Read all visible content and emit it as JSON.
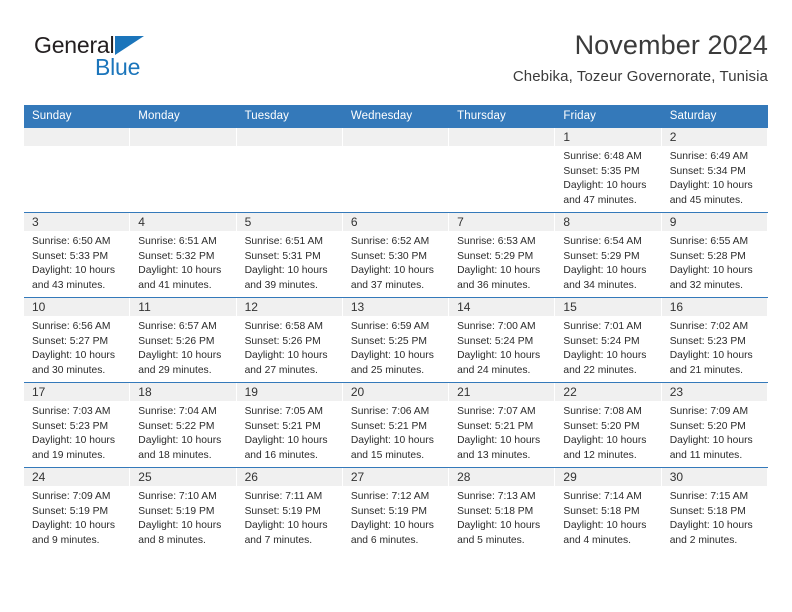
{
  "brand": {
    "name_part1": "General",
    "name_part2": "Blue",
    "logo_icon": "blue-triangle-icon",
    "accent_color": "#1b75bb"
  },
  "header": {
    "title": "November 2024",
    "subtitle": "Chebika, Tozeur Governorate, Tunisia"
  },
  "colors": {
    "header_row_background": "#3479ba",
    "daynum_band_background": "#f0f0f0",
    "text": "#2b2b2b",
    "page_background": "#ffffff"
  },
  "weekday_headers": [
    "Sunday",
    "Monday",
    "Tuesday",
    "Wednesday",
    "Thursday",
    "Friday",
    "Saturday"
  ],
  "weeks": [
    [
      {
        "day": "",
        "sunrise": "",
        "sunset": "",
        "daylight_line1": "",
        "daylight_line2": ""
      },
      {
        "day": "",
        "sunrise": "",
        "sunset": "",
        "daylight_line1": "",
        "daylight_line2": ""
      },
      {
        "day": "",
        "sunrise": "",
        "sunset": "",
        "daylight_line1": "",
        "daylight_line2": ""
      },
      {
        "day": "",
        "sunrise": "",
        "sunset": "",
        "daylight_line1": "",
        "daylight_line2": ""
      },
      {
        "day": "",
        "sunrise": "",
        "sunset": "",
        "daylight_line1": "",
        "daylight_line2": ""
      },
      {
        "day": "1",
        "sunrise": "Sunrise: 6:48 AM",
        "sunset": "Sunset: 5:35 PM",
        "daylight_line1": "Daylight: 10 hours",
        "daylight_line2": "and 47 minutes."
      },
      {
        "day": "2",
        "sunrise": "Sunrise: 6:49 AM",
        "sunset": "Sunset: 5:34 PM",
        "daylight_line1": "Daylight: 10 hours",
        "daylight_line2": "and 45 minutes."
      }
    ],
    [
      {
        "day": "3",
        "sunrise": "Sunrise: 6:50 AM",
        "sunset": "Sunset: 5:33 PM",
        "daylight_line1": "Daylight: 10 hours",
        "daylight_line2": "and 43 minutes."
      },
      {
        "day": "4",
        "sunrise": "Sunrise: 6:51 AM",
        "sunset": "Sunset: 5:32 PM",
        "daylight_line1": "Daylight: 10 hours",
        "daylight_line2": "and 41 minutes."
      },
      {
        "day": "5",
        "sunrise": "Sunrise: 6:51 AM",
        "sunset": "Sunset: 5:31 PM",
        "daylight_line1": "Daylight: 10 hours",
        "daylight_line2": "and 39 minutes."
      },
      {
        "day": "6",
        "sunrise": "Sunrise: 6:52 AM",
        "sunset": "Sunset: 5:30 PM",
        "daylight_line1": "Daylight: 10 hours",
        "daylight_line2": "and 37 minutes."
      },
      {
        "day": "7",
        "sunrise": "Sunrise: 6:53 AM",
        "sunset": "Sunset: 5:29 PM",
        "daylight_line1": "Daylight: 10 hours",
        "daylight_line2": "and 36 minutes."
      },
      {
        "day": "8",
        "sunrise": "Sunrise: 6:54 AM",
        "sunset": "Sunset: 5:29 PM",
        "daylight_line1": "Daylight: 10 hours",
        "daylight_line2": "and 34 minutes."
      },
      {
        "day": "9",
        "sunrise": "Sunrise: 6:55 AM",
        "sunset": "Sunset: 5:28 PM",
        "daylight_line1": "Daylight: 10 hours",
        "daylight_line2": "and 32 minutes."
      }
    ],
    [
      {
        "day": "10",
        "sunrise": "Sunrise: 6:56 AM",
        "sunset": "Sunset: 5:27 PM",
        "daylight_line1": "Daylight: 10 hours",
        "daylight_line2": "and 30 minutes."
      },
      {
        "day": "11",
        "sunrise": "Sunrise: 6:57 AM",
        "sunset": "Sunset: 5:26 PM",
        "daylight_line1": "Daylight: 10 hours",
        "daylight_line2": "and 29 minutes."
      },
      {
        "day": "12",
        "sunrise": "Sunrise: 6:58 AM",
        "sunset": "Sunset: 5:26 PM",
        "daylight_line1": "Daylight: 10 hours",
        "daylight_line2": "and 27 minutes."
      },
      {
        "day": "13",
        "sunrise": "Sunrise: 6:59 AM",
        "sunset": "Sunset: 5:25 PM",
        "daylight_line1": "Daylight: 10 hours",
        "daylight_line2": "and 25 minutes."
      },
      {
        "day": "14",
        "sunrise": "Sunrise: 7:00 AM",
        "sunset": "Sunset: 5:24 PM",
        "daylight_line1": "Daylight: 10 hours",
        "daylight_line2": "and 24 minutes."
      },
      {
        "day": "15",
        "sunrise": "Sunrise: 7:01 AM",
        "sunset": "Sunset: 5:24 PM",
        "daylight_line1": "Daylight: 10 hours",
        "daylight_line2": "and 22 minutes."
      },
      {
        "day": "16",
        "sunrise": "Sunrise: 7:02 AM",
        "sunset": "Sunset: 5:23 PM",
        "daylight_line1": "Daylight: 10 hours",
        "daylight_line2": "and 21 minutes."
      }
    ],
    [
      {
        "day": "17",
        "sunrise": "Sunrise: 7:03 AM",
        "sunset": "Sunset: 5:23 PM",
        "daylight_line1": "Daylight: 10 hours",
        "daylight_line2": "and 19 minutes."
      },
      {
        "day": "18",
        "sunrise": "Sunrise: 7:04 AM",
        "sunset": "Sunset: 5:22 PM",
        "daylight_line1": "Daylight: 10 hours",
        "daylight_line2": "and 18 minutes."
      },
      {
        "day": "19",
        "sunrise": "Sunrise: 7:05 AM",
        "sunset": "Sunset: 5:21 PM",
        "daylight_line1": "Daylight: 10 hours",
        "daylight_line2": "and 16 minutes."
      },
      {
        "day": "20",
        "sunrise": "Sunrise: 7:06 AM",
        "sunset": "Sunset: 5:21 PM",
        "daylight_line1": "Daylight: 10 hours",
        "daylight_line2": "and 15 minutes."
      },
      {
        "day": "21",
        "sunrise": "Sunrise: 7:07 AM",
        "sunset": "Sunset: 5:21 PM",
        "daylight_line1": "Daylight: 10 hours",
        "daylight_line2": "and 13 minutes."
      },
      {
        "day": "22",
        "sunrise": "Sunrise: 7:08 AM",
        "sunset": "Sunset: 5:20 PM",
        "daylight_line1": "Daylight: 10 hours",
        "daylight_line2": "and 12 minutes."
      },
      {
        "day": "23",
        "sunrise": "Sunrise: 7:09 AM",
        "sunset": "Sunset: 5:20 PM",
        "daylight_line1": "Daylight: 10 hours",
        "daylight_line2": "and 11 minutes."
      }
    ],
    [
      {
        "day": "24",
        "sunrise": "Sunrise: 7:09 AM",
        "sunset": "Sunset: 5:19 PM",
        "daylight_line1": "Daylight: 10 hours",
        "daylight_line2": "and 9 minutes."
      },
      {
        "day": "25",
        "sunrise": "Sunrise: 7:10 AM",
        "sunset": "Sunset: 5:19 PM",
        "daylight_line1": "Daylight: 10 hours",
        "daylight_line2": "and 8 minutes."
      },
      {
        "day": "26",
        "sunrise": "Sunrise: 7:11 AM",
        "sunset": "Sunset: 5:19 PM",
        "daylight_line1": "Daylight: 10 hours",
        "daylight_line2": "and 7 minutes."
      },
      {
        "day": "27",
        "sunrise": "Sunrise: 7:12 AM",
        "sunset": "Sunset: 5:19 PM",
        "daylight_line1": "Daylight: 10 hours",
        "daylight_line2": "and 6 minutes."
      },
      {
        "day": "28",
        "sunrise": "Sunrise: 7:13 AM",
        "sunset": "Sunset: 5:18 PM",
        "daylight_line1": "Daylight: 10 hours",
        "daylight_line2": "and 5 minutes."
      },
      {
        "day": "29",
        "sunrise": "Sunrise: 7:14 AM",
        "sunset": "Sunset: 5:18 PM",
        "daylight_line1": "Daylight: 10 hours",
        "daylight_line2": "and 4 minutes."
      },
      {
        "day": "30",
        "sunrise": "Sunrise: 7:15 AM",
        "sunset": "Sunset: 5:18 PM",
        "daylight_line1": "Daylight: 10 hours",
        "daylight_line2": "and 2 minutes."
      }
    ]
  ]
}
